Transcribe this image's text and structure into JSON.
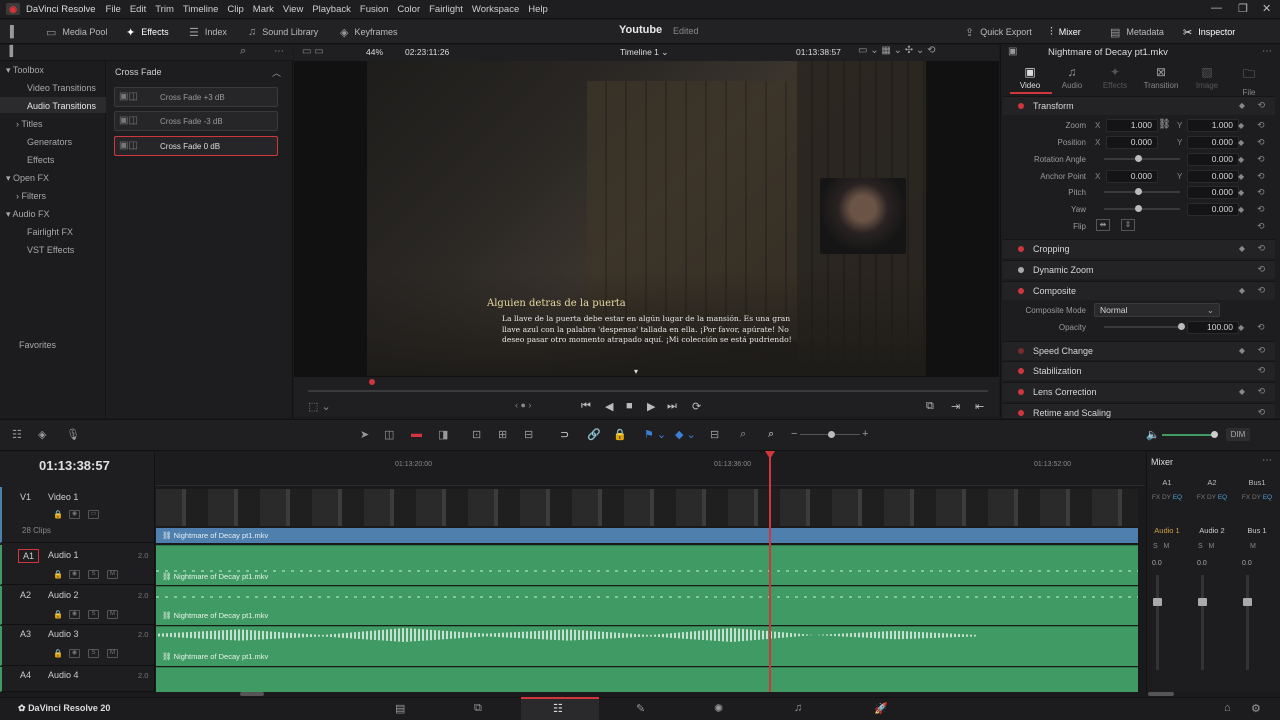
{
  "menubar": {
    "app_name": "DaVinci Resolve",
    "items": [
      "File",
      "Edit",
      "Trim",
      "Timeline",
      "Clip",
      "Mark",
      "View",
      "Playback",
      "Fusion",
      "Color",
      "Fairlight",
      "Workspace",
      "Help"
    ]
  },
  "toolbar": {
    "media_pool": "Media Pool",
    "effects": "Effects",
    "index": "Index",
    "sound_library": "Sound Library",
    "keyframes": "Keyframes",
    "project_title": "Youtube",
    "project_status": "Edited",
    "quick_export": "Quick Export",
    "mixer": "Mixer",
    "metadata": "Metadata",
    "inspector": "Inspector"
  },
  "viewer": {
    "zoom": "44%",
    "source_timecode": "02:23:11:26",
    "timeline_name": "Timeline 1",
    "record_timecode": "01:13:38:57",
    "subtitle_title": "Alguien detras de la puerta",
    "subtitle_text": "La llave de la puerta debe estar en algún lugar de la mansión. Es una gran llave azul con la palabra 'despensa' tallada en ella. ¡Por favor, apúrate! No deseo pasar otro momento atrapado aquí. ¡Mi colección se está pudriendo!"
  },
  "toolbox": {
    "items": {
      "toolbox": "Toolbox",
      "video_transitions": "Video Transitions",
      "audio_transitions": "Audio Transitions",
      "titles": "Titles",
      "generators": "Generators",
      "effects": "Effects",
      "open_fx": "Open FX",
      "filters": "Filters",
      "audio_fx": "Audio FX",
      "fairlight_fx": "Fairlight FX",
      "vst_effects": "VST Effects",
      "favorites": "Favorites"
    },
    "list_header": "Cross Fade",
    "effects_list": [
      "Cross Fade +3 dB",
      "Cross Fade -3 dB",
      "Cross Fade 0 dB"
    ]
  },
  "inspector": {
    "clip_title": "Nightmare of Decay pt1.mkv",
    "tabs": [
      "Video",
      "Audio",
      "Effects",
      "Transition",
      "Image",
      "File"
    ],
    "sections": {
      "transform": "Transform",
      "cropping": "Cropping",
      "dynamic_zoom": "Dynamic Zoom",
      "composite": "Composite",
      "speed_change": "Speed Change",
      "stabilization": "Stabilization",
      "lens_correction": "Lens Correction",
      "retime_scaling": "Retime and Scaling"
    },
    "props": {
      "zoom": "Zoom",
      "position": "Position",
      "rotation_angle": "Rotation Angle",
      "anchor_point": "Anchor Point",
      "pitch": "Pitch",
      "yaw": "Yaw",
      "flip": "Flip",
      "composite_mode": "Composite Mode",
      "opacity": "Opacity"
    },
    "axis_x": "X",
    "axis_y": "Y",
    "values": {
      "zoom_x": "1.000",
      "zoom_y": "1.000",
      "position_x": "0.000",
      "position_y": "0.000",
      "rotation": "0.000",
      "anchor_x": "0.000",
      "anchor_y": "0.000",
      "pitch": "0.000",
      "yaw": "0.000",
      "composite_mode": "Normal",
      "opacity": "100.00"
    }
  },
  "timeline": {
    "timecode": "01:13:38:57",
    "ruler": [
      "01:13:20:00",
      "01:13:36:00",
      "01:13:52:00"
    ],
    "clips_count": "28 Clips",
    "tracks": [
      {
        "id": "V1",
        "name": "Video 1"
      },
      {
        "id": "A1",
        "name": "Audio 1",
        "vol": "2.0"
      },
      {
        "id": "A2",
        "name": "Audio 2",
        "vol": "2.0"
      },
      {
        "id": "A3",
        "name": "Audio 3",
        "vol": "2.0"
      },
      {
        "id": "A4",
        "name": "Audio 4",
        "vol": "2.0"
      }
    ],
    "clip_name": "Nightmare of Decay pt1.mkv",
    "dim": "DIM"
  },
  "mixer": {
    "title": "Mixer",
    "columns": [
      "A1",
      "A2",
      "Bus1"
    ],
    "channel_names": [
      "Audio 1",
      "Audio 2",
      "Bus 1"
    ],
    "fx_labels": [
      "FX",
      "DY",
      "EQ"
    ],
    "level": "0.0"
  },
  "pagebar": {
    "brand": "DaVinci Resolve 20"
  }
}
